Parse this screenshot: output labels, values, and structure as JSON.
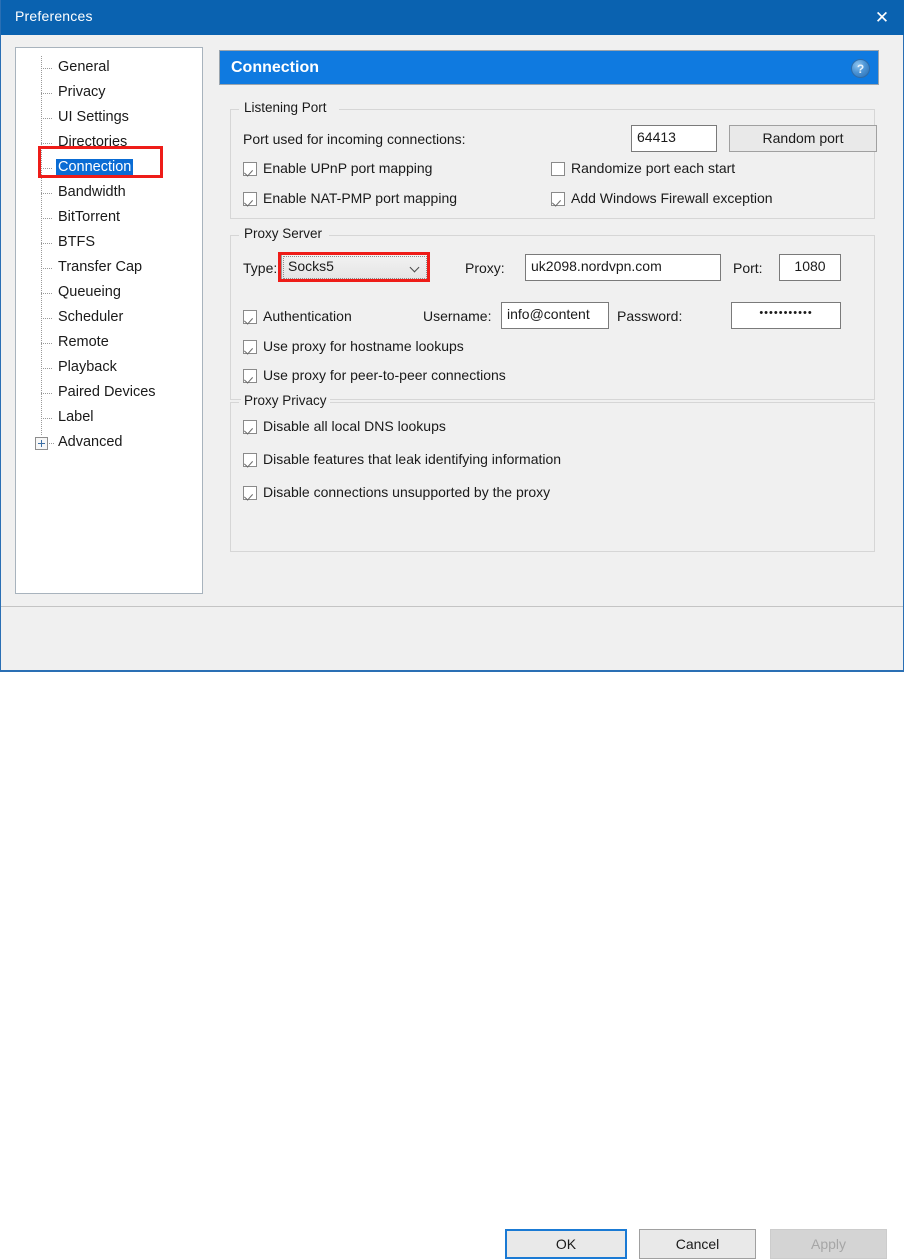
{
  "window": {
    "title": "Preferences",
    "close_icon": "close-icon"
  },
  "sidebar": {
    "items": [
      {
        "label": "General",
        "selected": false,
        "expandable": false
      },
      {
        "label": "Privacy",
        "selected": false,
        "expandable": false
      },
      {
        "label": "UI Settings",
        "selected": false,
        "expandable": false
      },
      {
        "label": "Directories",
        "selected": false,
        "expandable": false
      },
      {
        "label": "Connection",
        "selected": true,
        "expandable": false
      },
      {
        "label": "Bandwidth",
        "selected": false,
        "expandable": false
      },
      {
        "label": "BitTorrent",
        "selected": false,
        "expandable": false
      },
      {
        "label": "BTFS",
        "selected": false,
        "expandable": false
      },
      {
        "label": "Transfer Cap",
        "selected": false,
        "expandable": false
      },
      {
        "label": "Queueing",
        "selected": false,
        "expandable": false
      },
      {
        "label": "Scheduler",
        "selected": false,
        "expandable": false
      },
      {
        "label": "Remote",
        "selected": false,
        "expandable": false
      },
      {
        "label": "Playback",
        "selected": false,
        "expandable": false
      },
      {
        "label": "Paired Devices",
        "selected": false,
        "expandable": false
      },
      {
        "label": "Label",
        "selected": false,
        "expandable": false
      },
      {
        "label": "Advanced",
        "selected": false,
        "expandable": true
      }
    ]
  },
  "pane": {
    "title": "Connection",
    "help_icon": "question-mark-icon"
  },
  "listening_port": {
    "group_label": "Listening Port",
    "port_label": "Port used for incoming connections:",
    "port_value": "64413",
    "random_port_button": "Random port",
    "upnp": {
      "label": "Enable UPnP port mapping",
      "checked": true
    },
    "natpmp": {
      "label": "Enable NAT-PMP port mapping",
      "checked": true
    },
    "randomize": {
      "label": "Randomize port each start",
      "checked": false
    },
    "firewall": {
      "label": "Add Windows Firewall exception",
      "checked": true
    }
  },
  "proxy_server": {
    "group_label": "Proxy Server",
    "type_label": "Type:",
    "type_value": "Socks5",
    "proxy_label": "Proxy:",
    "proxy_value": "uk2098.nordvpn.com",
    "port_label": "Port:",
    "port_value": "1080",
    "auth": {
      "label": "Authentication",
      "checked": true
    },
    "username_label": "Username:",
    "username_value": "info@content",
    "password_label": "Password:",
    "password_value": "•••••••••••",
    "hostname_lookups": {
      "label": "Use proxy for hostname lookups",
      "checked": true
    },
    "p2p": {
      "label": "Use proxy for peer-to-peer connections",
      "checked": true
    }
  },
  "proxy_privacy": {
    "group_label": "Proxy Privacy",
    "dns": {
      "label": "Disable all local DNS lookups",
      "checked": true
    },
    "leak": {
      "label": "Disable features that leak identifying information",
      "checked": true
    },
    "unsupported": {
      "label": "Disable connections unsupported by the proxy",
      "checked": true
    }
  },
  "footer": {
    "ok": "OK",
    "cancel": "Cancel",
    "apply": "Apply"
  },
  "annotations": {
    "accent_red": "#ee1c18",
    "accent_blue": "#0a62b0",
    "selection_blue": "#0a6cd4"
  }
}
